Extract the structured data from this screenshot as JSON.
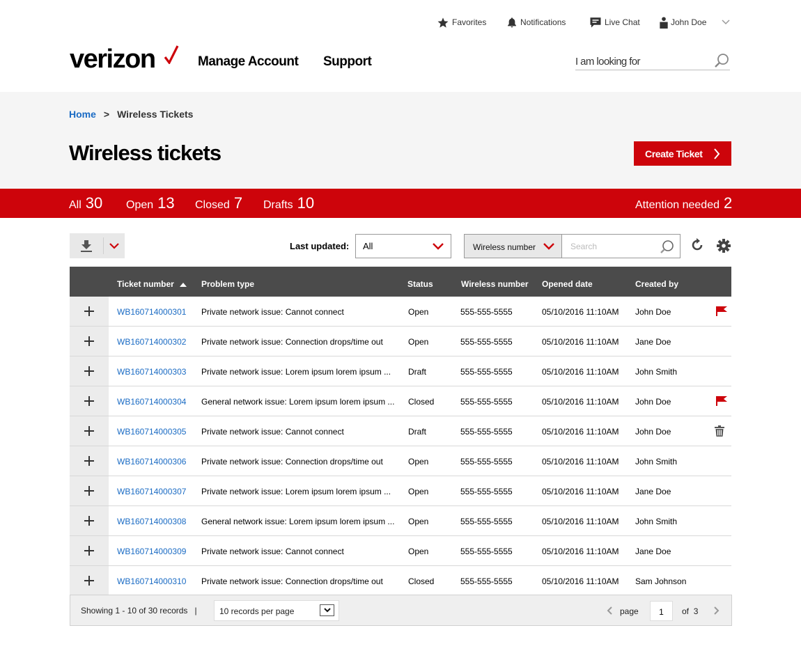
{
  "utility_nav": {
    "favorites": "Favorites",
    "notifications": "Notifications",
    "live_chat": "Live Chat",
    "user_name": "John Doe"
  },
  "header": {
    "logo_text": "verizon",
    "nav": [
      "Manage Account",
      "Support"
    ],
    "search_placeholder": "I am looking for"
  },
  "breadcrumb": {
    "home": "Home",
    "separator": ">",
    "current": "Wireless Tickets"
  },
  "page": {
    "title": "Wireless tickets",
    "create_button": "Create Ticket"
  },
  "status_bar": {
    "filters": [
      {
        "label": "All",
        "count": "30"
      },
      {
        "label": "Open",
        "count": "13"
      },
      {
        "label": "Closed",
        "count": "7"
      },
      {
        "label": "Drafts",
        "count": "10"
      }
    ],
    "attention": {
      "label": "Attention needed",
      "count": "2"
    }
  },
  "toolbar": {
    "last_updated_label": "Last updated:",
    "last_updated_value": "All",
    "search_field": "Wireless number",
    "search_placeholder": "Search"
  },
  "table": {
    "columns": [
      "Ticket number",
      "Problem type",
      "Status",
      "Wireless number",
      "Opened date",
      "Created by"
    ],
    "sort_column": "Ticket number",
    "sort_direction": "ascending",
    "rows": [
      {
        "ticket": "WB160714000301",
        "problem": "Private network issue: Cannot connect",
        "status": "Open",
        "wireless": "555-555-5555",
        "opened": "05/10/2016 11:10AM",
        "created_by": "John Doe",
        "action": "flag"
      },
      {
        "ticket": "WB160714000302",
        "problem": "Private network issue: Connection drops/time out",
        "status": "Open",
        "wireless": "555-555-5555",
        "opened": "05/10/2016 11:10AM",
        "created_by": "Jane Doe",
        "action": ""
      },
      {
        "ticket": "WB160714000303",
        "problem": "Private network issue: Lorem ipsum lorem ipsum ...",
        "status": "Draft",
        "wireless": "555-555-5555",
        "opened": "05/10/2016 11:10AM",
        "created_by": "John Smith",
        "action": ""
      },
      {
        "ticket": "WB160714000304",
        "problem": "General network issue: Lorem ipsum lorem ipsum ...",
        "status": "Closed",
        "wireless": "555-555-5555",
        "opened": "05/10/2016 11:10AM",
        "created_by": "John Doe",
        "action": "flag"
      },
      {
        "ticket": "WB160714000305",
        "problem": "Private network issue: Cannot connect",
        "status": "Draft",
        "wireless": "555-555-5555",
        "opened": "05/10/2016 11:10AM",
        "created_by": "John Doe",
        "action": "delete"
      },
      {
        "ticket": "WB160714000306",
        "problem": "Private network issue: Connection drops/time out",
        "status": "Open",
        "wireless": "555-555-5555",
        "opened": "05/10/2016 11:10AM",
        "created_by": "John Smith",
        "action": ""
      },
      {
        "ticket": "WB160714000307",
        "problem": "Private network issue: Lorem ipsum lorem ipsum ...",
        "status": "Open",
        "wireless": "555-555-5555",
        "opened": "05/10/2016 11:10AM",
        "created_by": "Jane Doe",
        "action": ""
      },
      {
        "ticket": "WB160714000308",
        "problem": "General network issue: Lorem ipsum lorem ipsum ...",
        "status": "Open",
        "wireless": "555-555-5555",
        "opened": "05/10/2016 11:10AM",
        "created_by": "John Smith",
        "action": ""
      },
      {
        "ticket": "WB160714000309",
        "problem": "Private network issue: Cannot connect",
        "status": "Open",
        "wireless": "555-555-5555",
        "opened": "05/10/2016 11:10AM",
        "created_by": "Jane Doe",
        "action": ""
      },
      {
        "ticket": "WB160714000310",
        "problem": "Private network issue: Connection drops/time out",
        "status": "Closed",
        "wireless": "555-555-5555",
        "opened": "05/10/2016 11:10AM",
        "created_by": "Sam Johnson",
        "action": ""
      }
    ]
  },
  "footer": {
    "showing": "Showing 1 - 10 of 30 records",
    "separator": "|",
    "per_page": "10 records per page",
    "page_label": "page",
    "current_page": "1",
    "of_label": "of",
    "total_pages": "3"
  },
  "colors": {
    "brand_red": "#cd040b",
    "link_blue": "#1a6bc4",
    "header_dark": "#4b4b4b"
  }
}
